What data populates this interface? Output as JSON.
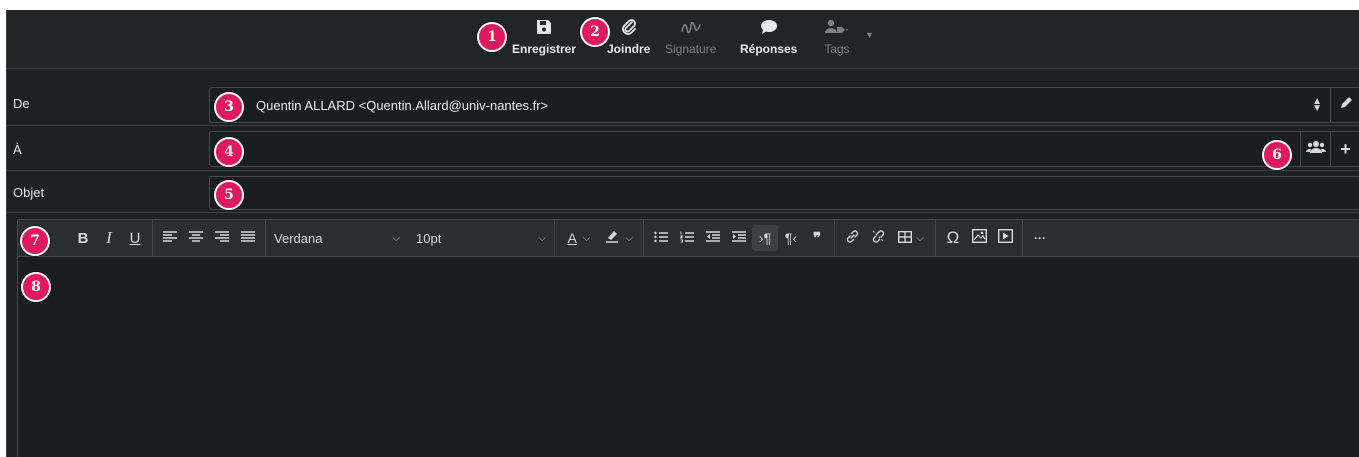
{
  "toolbar": {
    "save": "Enregistrer",
    "attach": "Joindre",
    "signature": "Signature",
    "responses": "Réponses",
    "tags": "Tags"
  },
  "headers": {
    "from_label": "De",
    "from_value": "Quentin ALLARD <Quentin.Allard@univ-nantes.fr>",
    "to_label": "À",
    "to_value": "",
    "subject_label": "Objet",
    "subject_value": ""
  },
  "editor_toolbar": {
    "font_family": "Verdana",
    "font_size": "10pt",
    "bold": "B",
    "italic": "I",
    "underline": "U",
    "special_char": "Ω",
    "quote": "❞",
    "more": "···"
  },
  "markers": [
    "1",
    "2",
    "3",
    "4",
    "5",
    "6",
    "7",
    "8"
  ],
  "colors": {
    "background": "#1e2124",
    "marker": "#e2185e",
    "text": "#e6e8ea",
    "disabled_text": "#7a8087"
  }
}
